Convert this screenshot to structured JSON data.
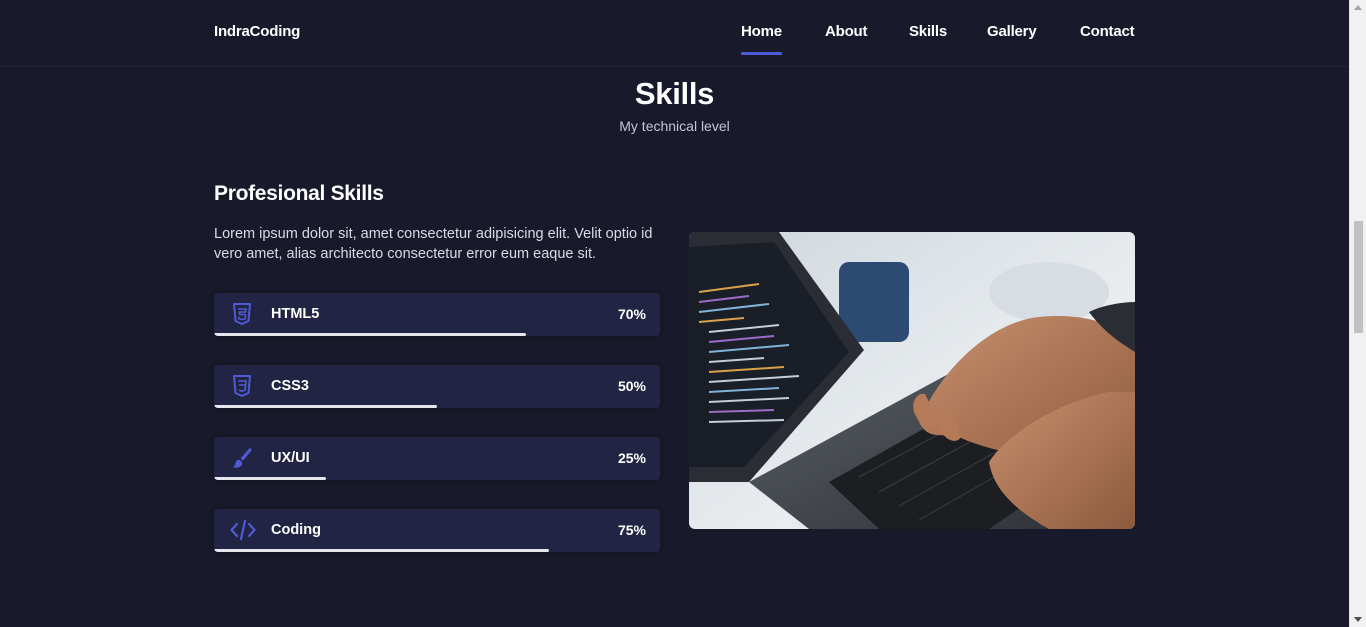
{
  "header": {
    "logo": "IndraCoding",
    "nav": [
      {
        "label": "Home",
        "active": true
      },
      {
        "label": "About",
        "active": false
      },
      {
        "label": "Skills",
        "active": false
      },
      {
        "label": "Gallery",
        "active": false
      },
      {
        "label": "Contact",
        "active": false
      }
    ]
  },
  "section": {
    "title": "Skills",
    "subtitle": "My technical level",
    "subheading": "Profesional Skills",
    "description": "Lorem ipsum dolor sit, amet consectetur adipisicing elit. Velit optio id vero amet, alias architecto consectetur error eum eaque sit."
  },
  "skills": [
    {
      "name": "HTML5",
      "percent": "70%",
      "level": 0.7,
      "icon": "html5-icon"
    },
    {
      "name": "CSS3",
      "percent": "50%",
      "level": 0.5,
      "icon": "css3-icon"
    },
    {
      "name": "UX/UI",
      "percent": "25%",
      "level": 0.25,
      "icon": "paintbrush-icon"
    },
    {
      "name": "Coding",
      "percent": "75%",
      "level": 0.75,
      "icon": "code-icon"
    }
  ],
  "colors": {
    "background": "#181a2b",
    "card": "#212442",
    "accent": "#4f5ad6",
    "bar": "#e6e6ee"
  },
  "image": {
    "alt": "laptop-typing-photo"
  }
}
